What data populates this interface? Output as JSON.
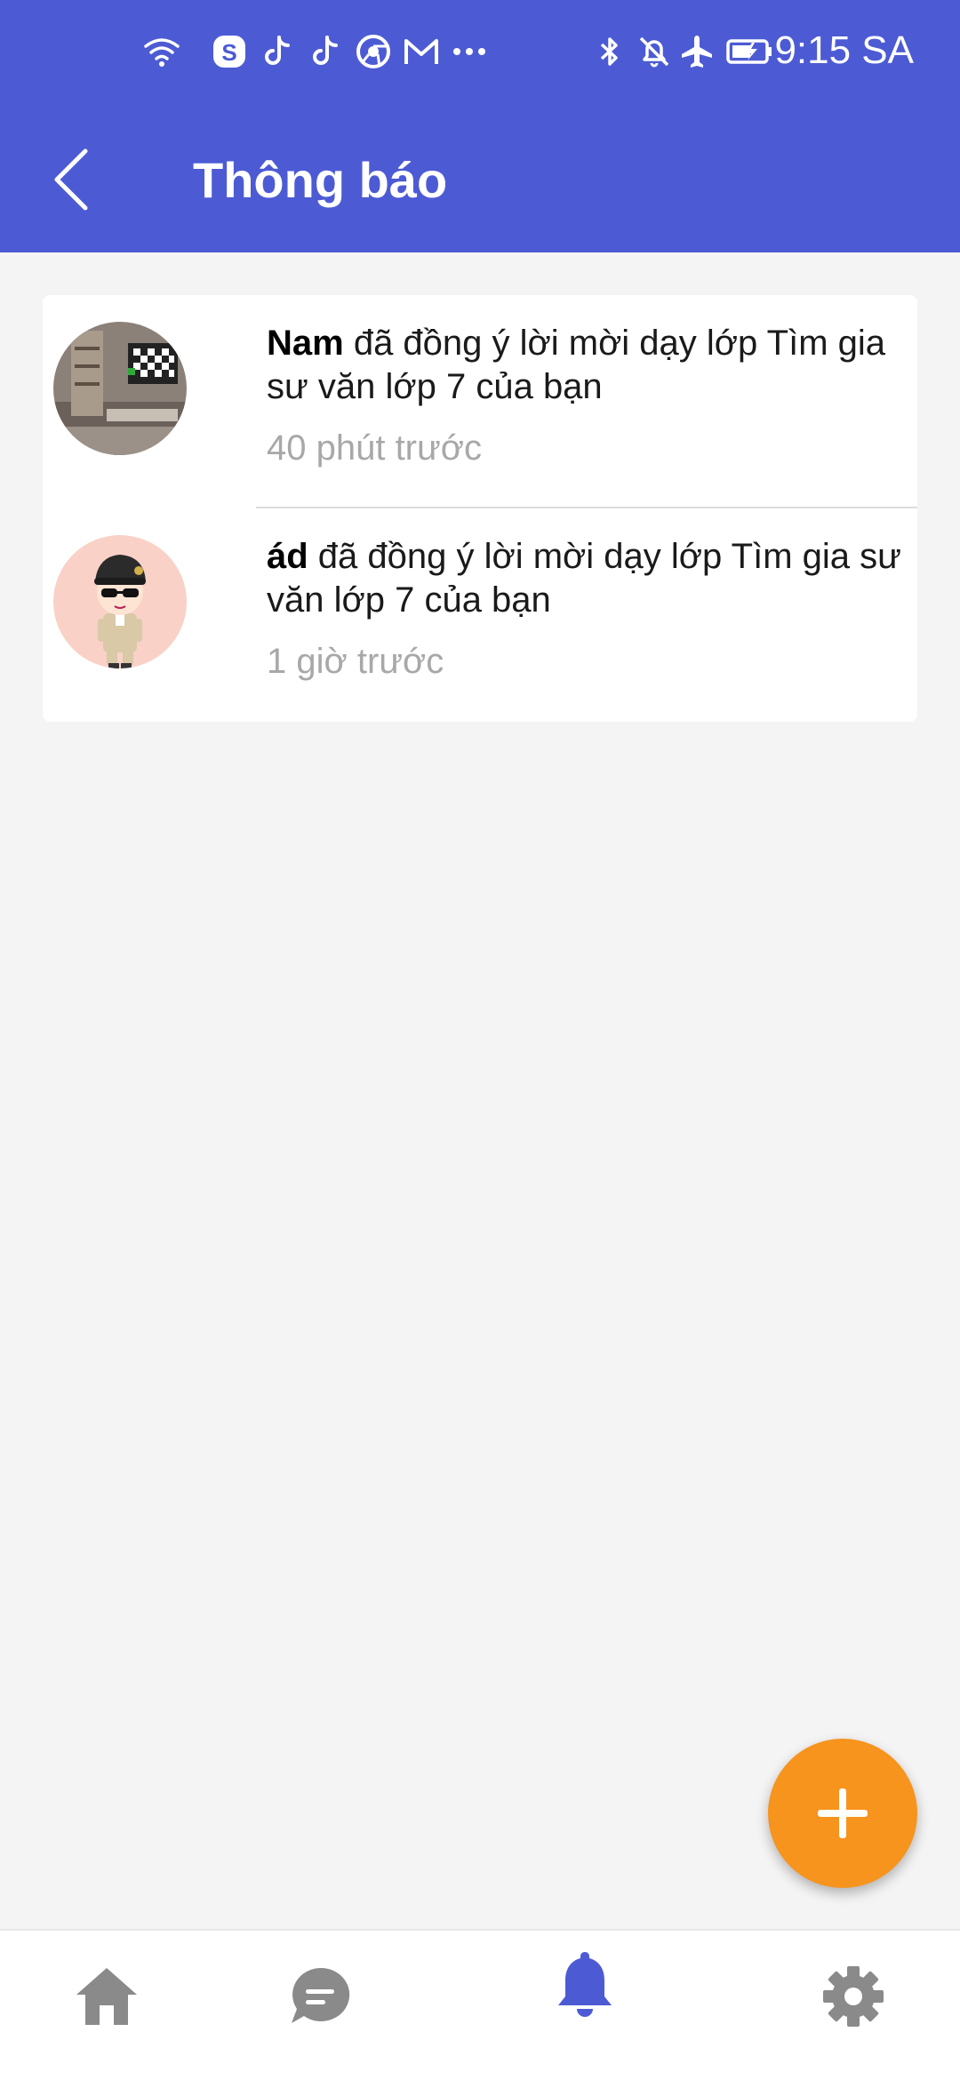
{
  "status_bar": {
    "time": "9:15 SA",
    "icons": [
      "wifi-icon",
      "skype-icon",
      "tiktok-icon",
      "tiktok-icon",
      "chrome-icon",
      "gmail-icon",
      "more-dots-icon",
      "bluetooth-icon",
      "notifications-off-icon",
      "airplane-mode-icon",
      "battery-charging-icon"
    ]
  },
  "header": {
    "title": "Thông báo",
    "back_icon": "chevron-left-icon",
    "background_color": "#4c5bd4"
  },
  "notifications": [
    {
      "sender": "Nam",
      "message": " đã đồng ý lời mời dạy lớp Tìm gia sư văn lớp 7 của bạn",
      "time": "40 phút trước",
      "avatar": "room-photo-avatar"
    },
    {
      "sender": "ád",
      "message": " đã đồng ý lời mời dạy lớp Tìm gia sư văn lớp 7 của bạn",
      "time": "1 giờ trước",
      "avatar": "cartoon-soldier-avatar"
    }
  ],
  "fab": {
    "icon": "plus-icon",
    "color": "#f7941d"
  },
  "bottom_nav": {
    "items": [
      {
        "icon": "home-icon",
        "active": false
      },
      {
        "icon": "chat-icon",
        "active": false
      },
      {
        "icon": "bell-icon",
        "active": true
      },
      {
        "icon": "gear-icon",
        "active": false
      }
    ],
    "active_color": "#4c5bd4",
    "inactive_color": "#8a8a8a"
  }
}
